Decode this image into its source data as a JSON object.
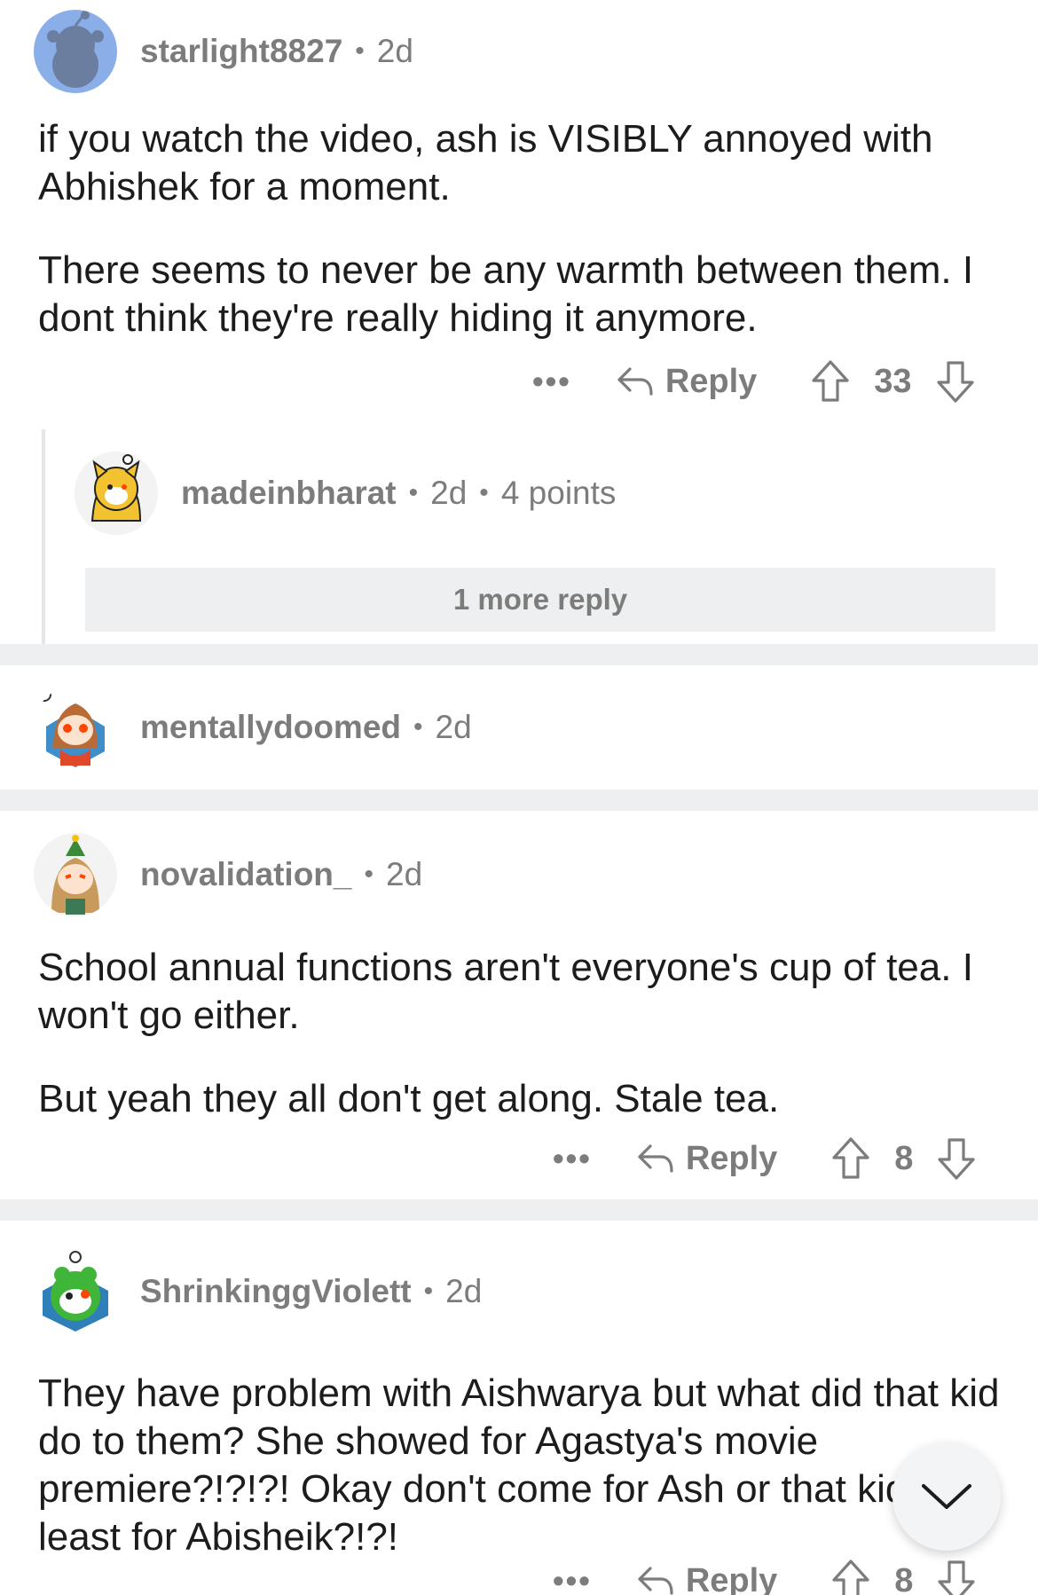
{
  "comments": [
    {
      "username": "starlight8827",
      "age": "2d",
      "paragraphs": [
        "if you watch the video, ash is VISIBLY annoyed with Abhishek for a moment.",
        "There seems to never be any warmth between them. I dont think they're really hiding it anymore."
      ],
      "reply_label": "Reply",
      "score": "33",
      "more_label": "•••"
    },
    {
      "username": "madeinbharat",
      "age": "2d",
      "points": "4 points",
      "more_replies_label": "1 more reply"
    },
    {
      "username": "mentallydoomed",
      "age": "2d"
    },
    {
      "username": "novalidation_",
      "age": "2d",
      "paragraphs": [
        "School annual functions aren't everyone's cup of tea. I won't go either.",
        "But yeah they all don't get along. Stale tea."
      ],
      "reply_label": "Reply",
      "score": "8",
      "more_label": "•••"
    },
    {
      "username": "ShrinkinggViolett",
      "age": "2d",
      "paragraphs": [
        "They have problem with Aishwarya but what did that kid do to them? She showed for Agastya's movie premiere?!?!?! Okay don't come for Ash or that kid at least for Abisheik?!?!"
      ],
      "reply_label": "Reply",
      "score": "8",
      "more_label": "•••"
    }
  ],
  "icons": {
    "reply": "reply-arrow-icon",
    "upvote": "upvote-arrow-icon",
    "downvote": "downvote-arrow-icon",
    "scroll": "chevron-down-icon"
  },
  "colors": {
    "meta_gray": "#7c7c7c",
    "separator": "#edeff1",
    "text": "#1c1c1c"
  }
}
